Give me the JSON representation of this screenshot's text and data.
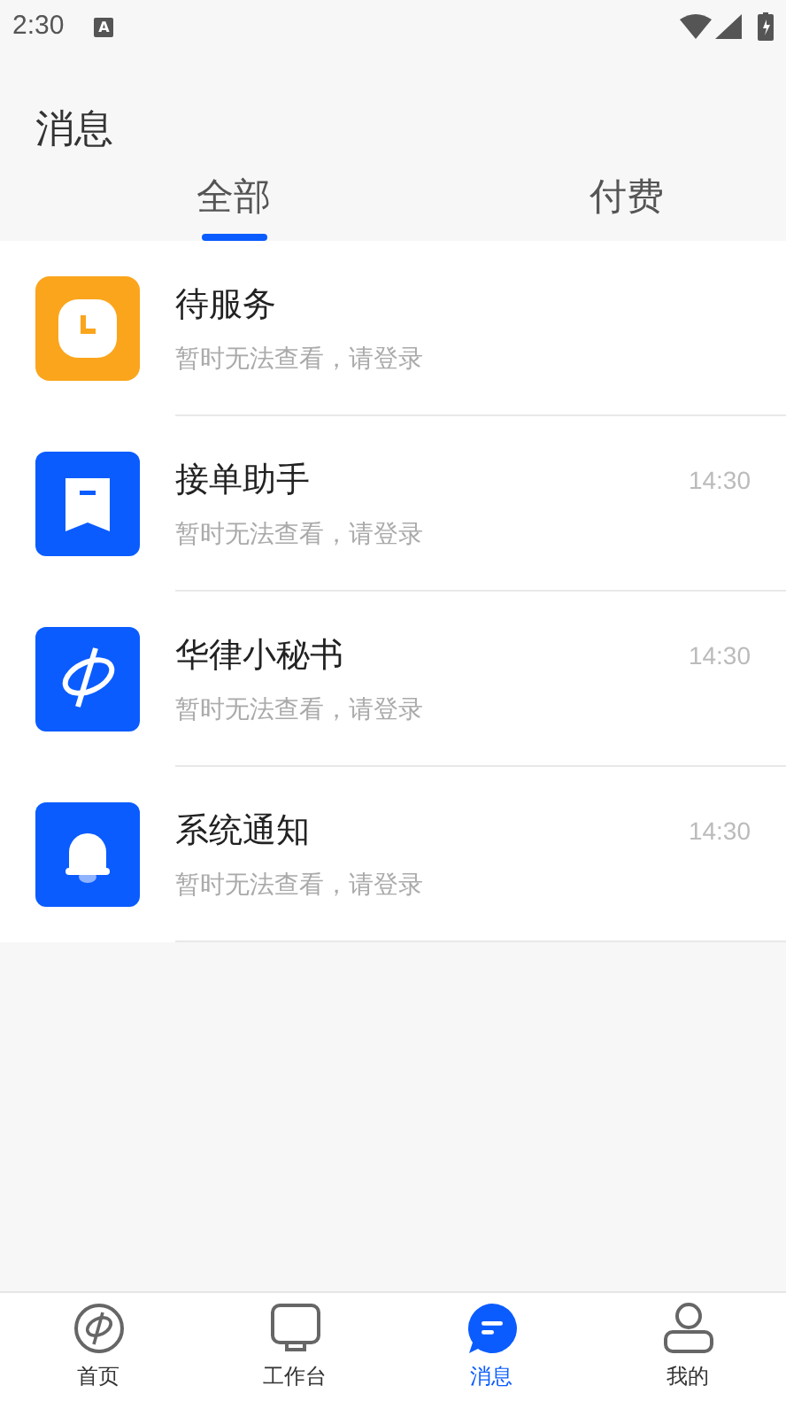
{
  "status_bar": {
    "time": "2:30",
    "notification": "A"
  },
  "header": {
    "title": "消息"
  },
  "tabs": [
    {
      "label": "全部",
      "selected": true
    },
    {
      "label": "付费",
      "selected": false
    }
  ],
  "messages": [
    {
      "kind": "clock",
      "title": "待服务",
      "subtitle": "暂时无法查看，请登录"
    },
    {
      "kind": "bookmark",
      "title": "接单助手",
      "subtitle": "暂时无法查看，请登录",
      "time": "14:30"
    },
    {
      "kind": "logo",
      "title": "华律小秘书",
      "subtitle": "暂时无法查看，请登录",
      "time": "14:30"
    },
    {
      "kind": "bell",
      "title": "系统通知",
      "subtitle": "暂时无法查看，请登录",
      "time": "14:30"
    }
  ],
  "bottom_nav": [
    {
      "kind": "home",
      "label": "首页",
      "selected": false
    },
    {
      "kind": "desk",
      "label": "工作台",
      "selected": false
    },
    {
      "kind": "chat",
      "label": "消息",
      "selected": true
    },
    {
      "kind": "user",
      "label": "我的",
      "selected": false
    }
  ]
}
